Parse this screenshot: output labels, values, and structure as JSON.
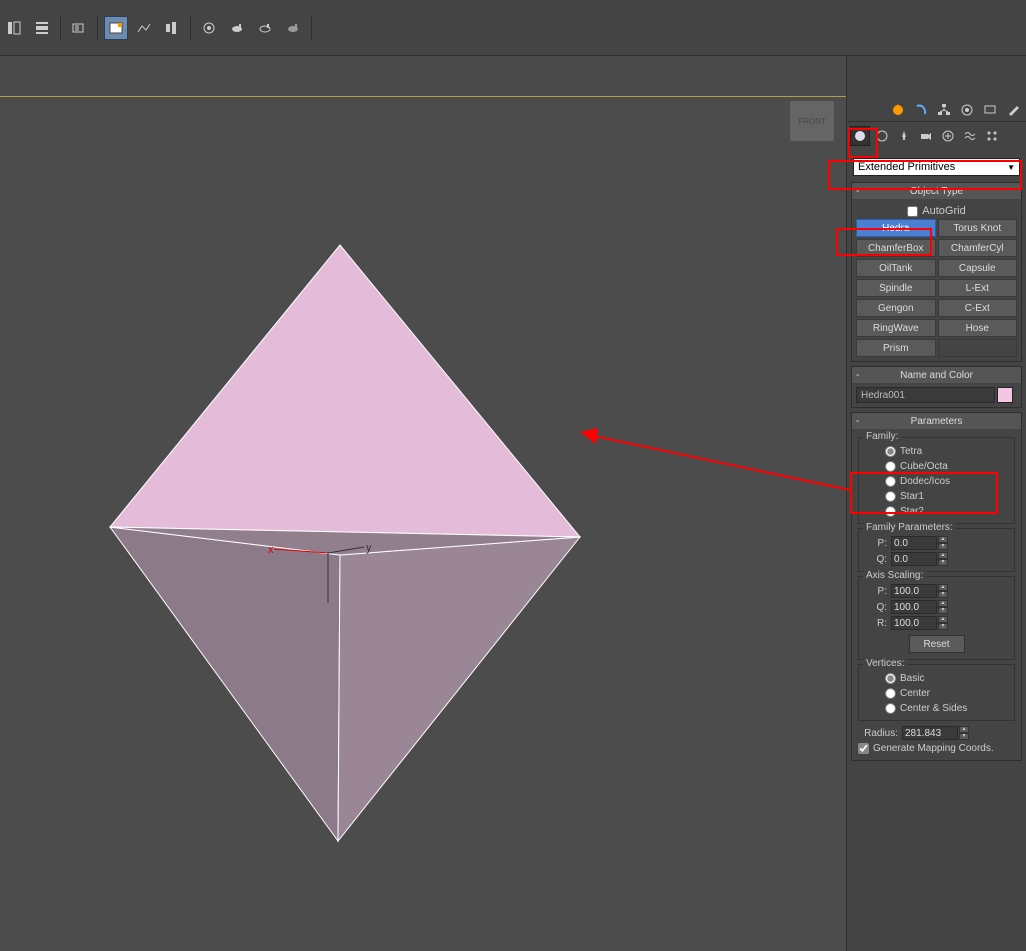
{
  "dropdown": {
    "selected": "Extended Primitives"
  },
  "objectType": {
    "title": "Object Type",
    "autogrid": "AutoGrid",
    "buttons": [
      [
        "Hedra",
        "Torus Knot"
      ],
      [
        "ChamferBox",
        "ChamferCyl"
      ],
      [
        "OilTank",
        "Capsule"
      ],
      [
        "Spindle",
        "L-Ext"
      ],
      [
        "Gengon",
        "C-Ext"
      ],
      [
        "RingWave",
        "Hose"
      ],
      [
        "Prism",
        ""
      ]
    ],
    "selected": "Hedra"
  },
  "nameColor": {
    "title": "Name and Color",
    "name": "Hedra001",
    "color": "#f4c6e4"
  },
  "parameters": {
    "title": "Parameters",
    "family": {
      "title": "Family:",
      "options": [
        "Tetra",
        "Cube/Octa",
        "Dodec/Icos",
        "Star1",
        "Star2"
      ],
      "selected": "Tetra"
    },
    "familyParams": {
      "title": "Family Parameters:",
      "P": "0.0",
      "Q": "0.0"
    },
    "axisScaling": {
      "title": "Axis Scaling:",
      "P": "100.0",
      "Q": "100.0",
      "R": "100.0",
      "reset": "Reset"
    },
    "vertices": {
      "title": "Vertices:",
      "options": [
        "Basic",
        "Center",
        "Center & Sides"
      ],
      "selected": "Basic"
    },
    "radius": {
      "label": "Radius:",
      "value": "281.843"
    },
    "genMapping": "Generate Mapping Coords."
  }
}
